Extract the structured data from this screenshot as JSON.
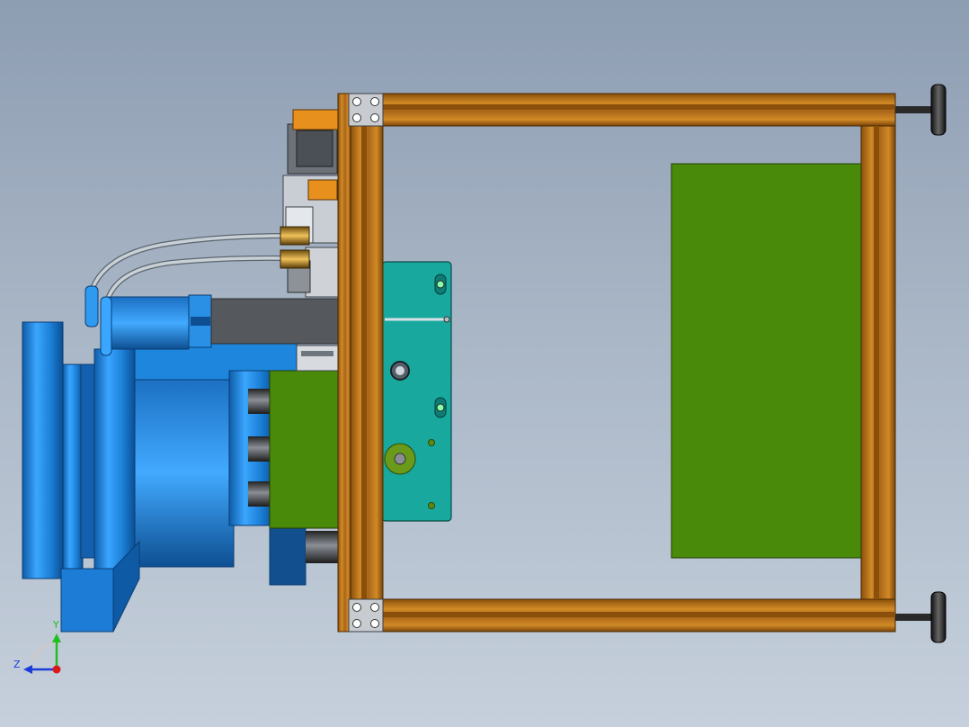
{
  "view": {
    "type": "CAD assembly viewport",
    "colors": {
      "background_top": "#8d9db2",
      "background_bottom": "#c6d0dc",
      "frame_profile": "#b8741a",
      "fixture_body": "#1a73c9",
      "controller_board": "#4a8a0a",
      "mounting_plate": "#18a89e",
      "bracket_block": "#e8901e"
    }
  },
  "triad": {
    "y_label": "Y",
    "z_label": "Z",
    "y_color": "#1fbf1f",
    "z_color": "#1a3cd8",
    "x_color": "#d81a1a"
  }
}
